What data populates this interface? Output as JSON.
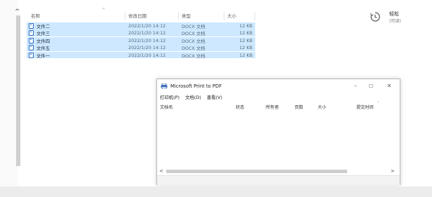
{
  "explorer": {
    "columns": {
      "name": "名称",
      "date": "修改日期",
      "type": "类型",
      "size": "大小"
    },
    "sort_caret": "^",
    "files": [
      {
        "name": "文件二",
        "date": "2022/1/20 14:12",
        "type": "DOCX 文档",
        "size": "12 KB"
      },
      {
        "name": "文件三",
        "date": "2022/1/20 14:12",
        "type": "DOCX 文档",
        "size": "12 KB"
      },
      {
        "name": "文件四",
        "date": "2022/1/20 14:12",
        "type": "DOCX 文档",
        "size": "12 KB"
      },
      {
        "name": "文件五",
        "date": "2022/1/20 14:12",
        "type": "DOCX 文档",
        "size": "12 KB"
      },
      {
        "name": "文件一",
        "date": "2022/1/20 14:12",
        "type": "DOCX 文档",
        "size": "12 KB"
      }
    ],
    "file_icon": "document-icon",
    "scroll_up_arrow": "^"
  },
  "right_pane": {
    "icon": "clock-icon",
    "title": "轻松",
    "subtitle": "(可读)"
  },
  "print_dialog": {
    "icon": "printer-icon",
    "title": "Microsoft Print to PDF",
    "window_buttons": {
      "minimize": "–",
      "maximize": "☐",
      "close": "✕"
    },
    "menu": [
      "打印机(P)",
      "文档(D)",
      "查看(V)"
    ],
    "columns": [
      "文档名",
      "状态",
      "所有者",
      "页数",
      "大小",
      "提交时间"
    ],
    "column_caret": "ˇ",
    "scroll_left": "<",
    "scroll_right": ">"
  },
  "colors": {
    "selection": "#cde8ff",
    "file_icon": "#2b6cc4",
    "printer_icon": "#3d6fb8"
  }
}
